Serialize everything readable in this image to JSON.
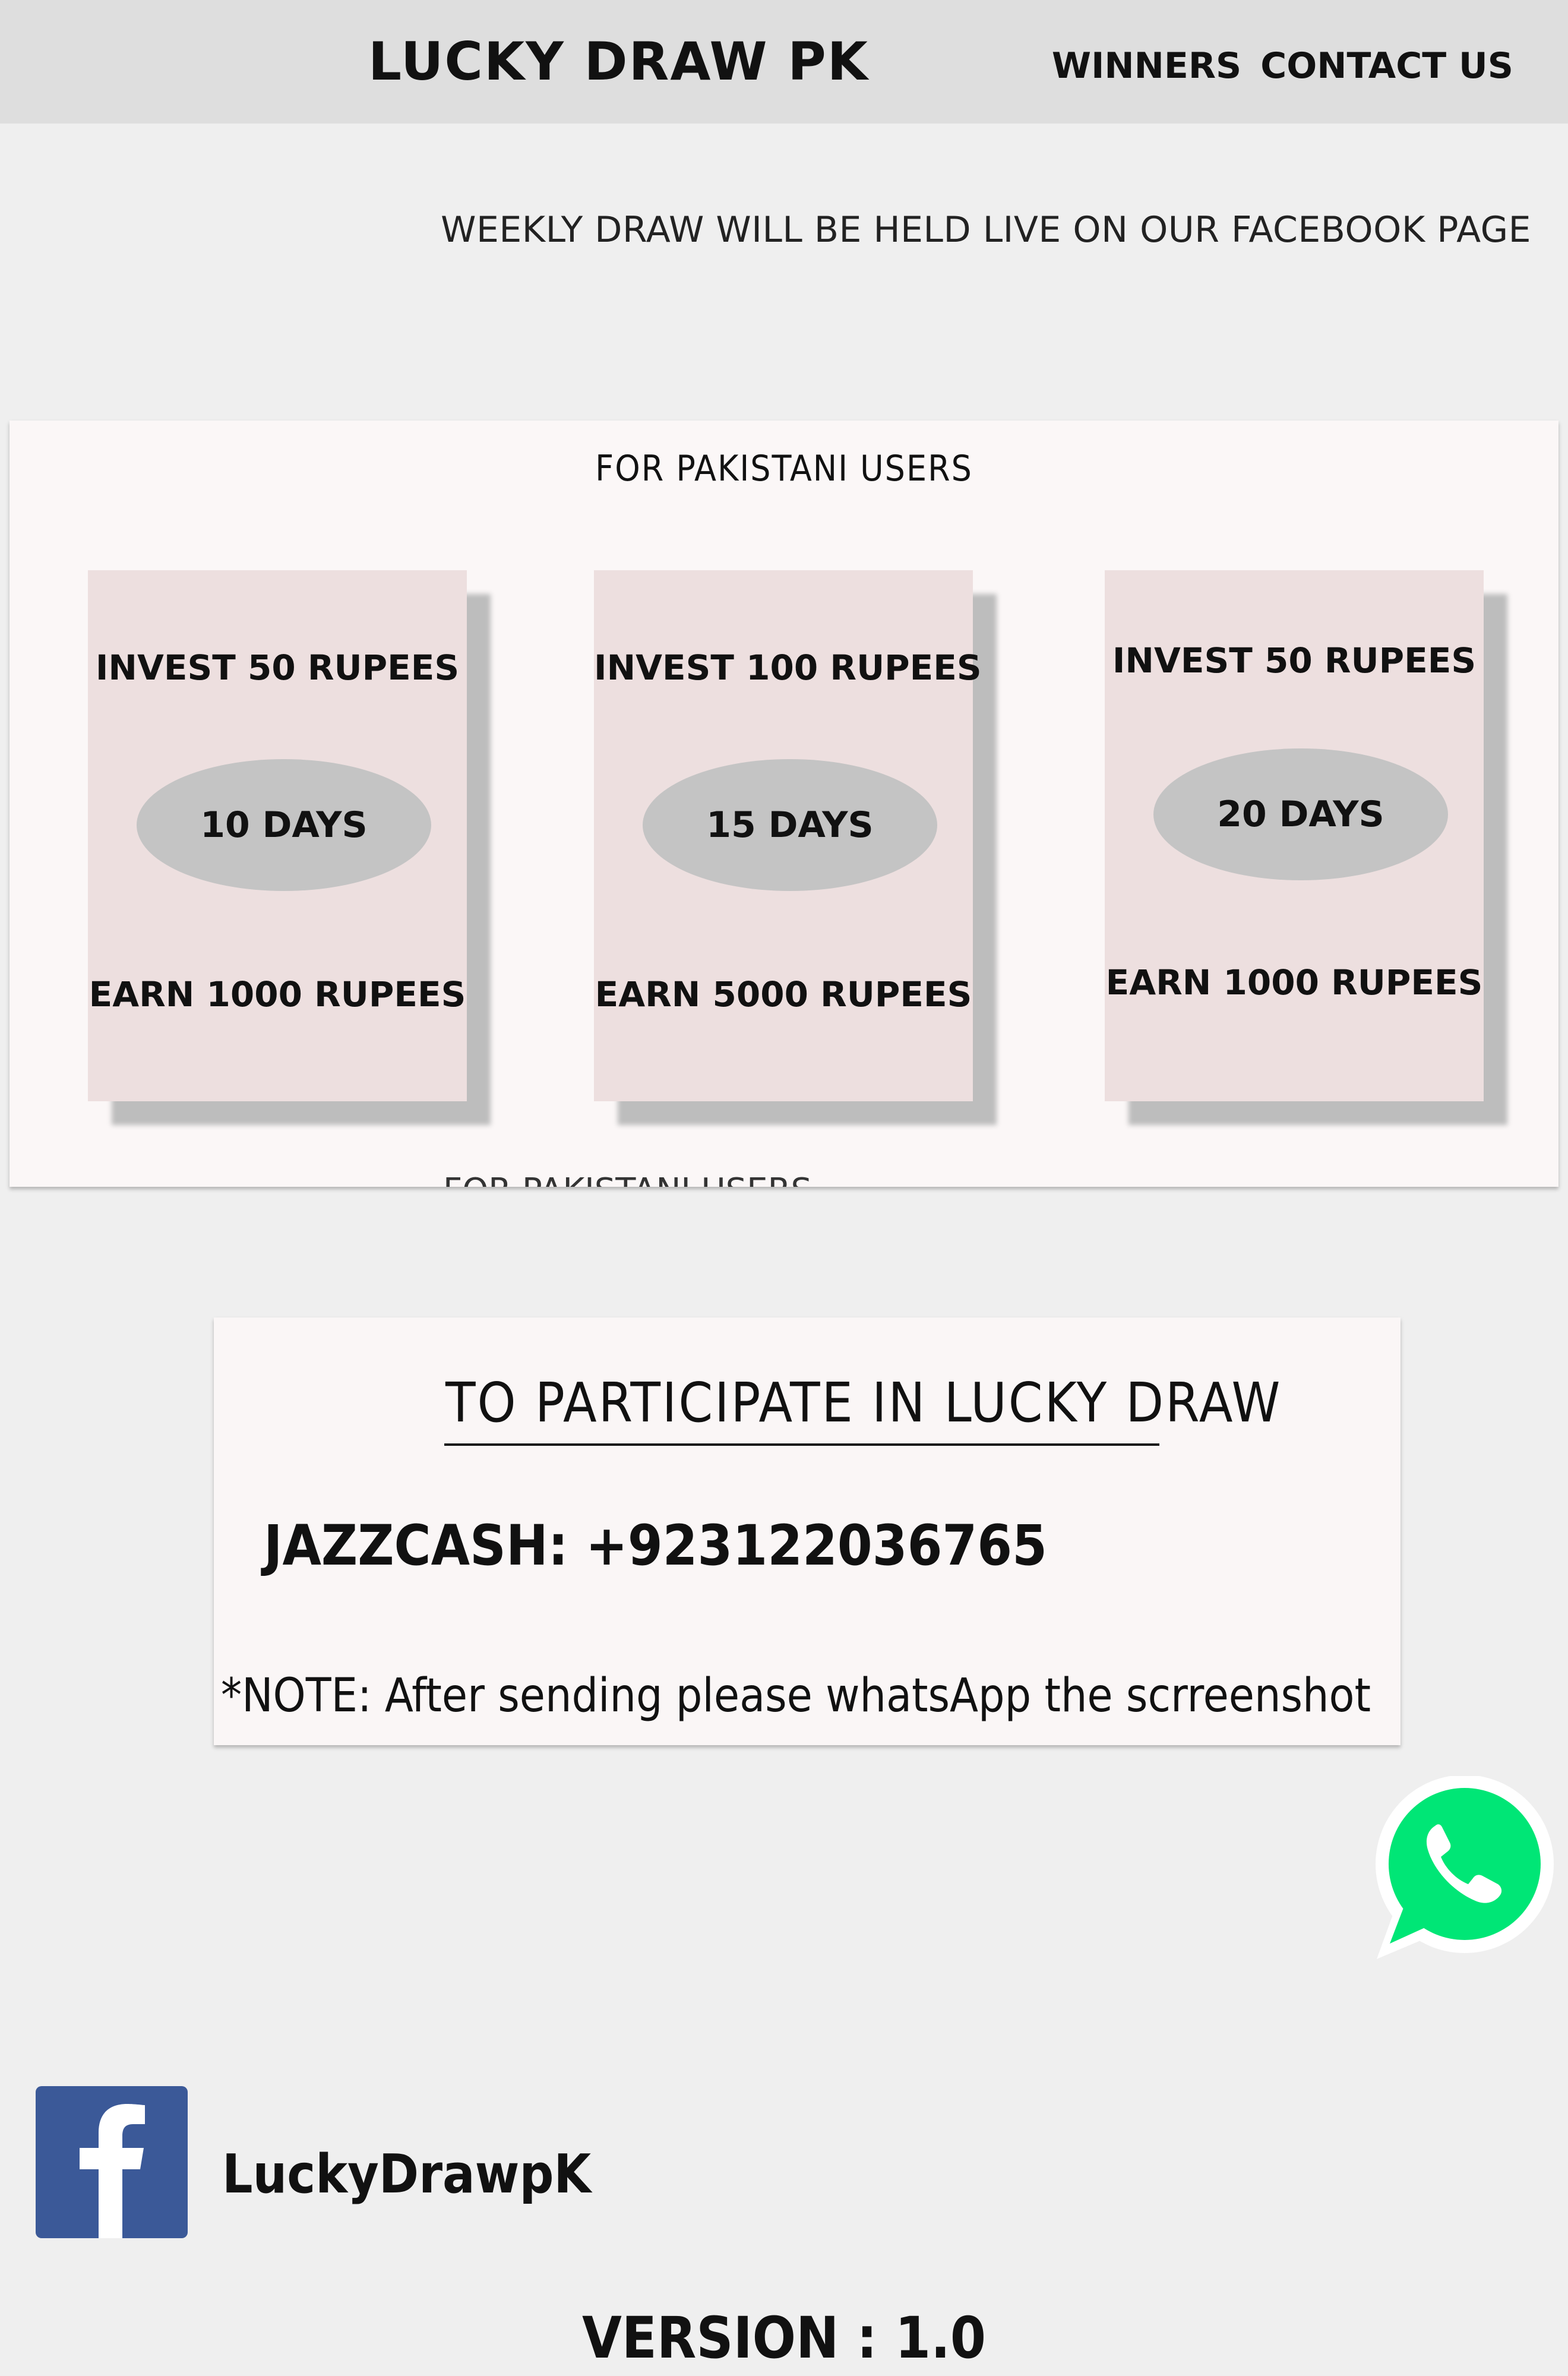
{
  "header": {
    "title": "LUCKY DRAW PK",
    "nav": {
      "winners": "WINNERS",
      "contact": "CONTACT US"
    }
  },
  "announcement": "WEEKLY DRAW WILL BE HELD LIVE ON OUR FACEBOOK PAGE",
  "plans": {
    "heading": "FOR PAKISTANI USERS",
    "ghost_heading": "FOR PAKISTANI USERS",
    "cards": [
      {
        "invest": "INVEST 50 RUPEES",
        "duration": "10 DAYS",
        "earn": "EARN 1000 RUPEES"
      },
      {
        "invest": "INVEST 100 RUPEES",
        "duration": "15 DAYS",
        "earn": "EARN 5000 RUPEES"
      },
      {
        "invest": "INVEST 50 RUPEES",
        "duration": "20 DAYS",
        "earn": "EARN 1000 RUPEES"
      }
    ]
  },
  "participate": {
    "heading": "TO PARTICIPATE IN LUCKY DRAW",
    "jazzcash": "JAZZCASH: +923122036765",
    "note": "*NOTE: After sending please whatsApp the scrreenshot"
  },
  "social": {
    "facebook_handle": "LuckyDrawpK",
    "facebook_icon": "facebook-icon",
    "whatsapp_icon": "whatsapp-icon"
  },
  "footer": {
    "version": "VERSION : 1.0"
  },
  "colors": {
    "header_bg": "#dedede",
    "page_bg": "#efefef",
    "card_bg": "#eddfdf",
    "duration_pill": "#c4c4c4",
    "whatsapp_green": "#00e676",
    "facebook_blue": "#3b5998"
  }
}
